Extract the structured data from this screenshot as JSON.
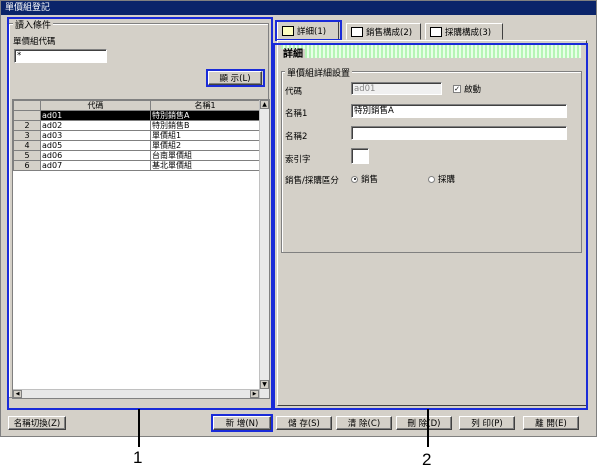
{
  "window": {
    "title": "單價組登記"
  },
  "left_panel": {
    "group_label": "讀入條件",
    "code_label": "單價組代碼",
    "code_value": "*",
    "show_button": "顯 示(L)",
    "grid": {
      "columns": [
        "代碼",
        "名稱1"
      ],
      "rows": [
        {
          "num": "",
          "code": "ad01",
          "name": "特別銷售A"
        },
        {
          "num": "2",
          "code": "ad02",
          "name": "特別銷售B"
        },
        {
          "num": "3",
          "code": "ad03",
          "name": "單價組1"
        },
        {
          "num": "4",
          "code": "ad05",
          "name": "單價組2"
        },
        {
          "num": "5",
          "code": "ad06",
          "name": "台南單價組"
        },
        {
          "num": "6",
          "code": "ad07",
          "name": "基北單價組"
        }
      ]
    }
  },
  "tabs": [
    {
      "label": "詳細(1)"
    },
    {
      "label": "銷售構成(2)"
    },
    {
      "label": "採購構成(3)"
    }
  ],
  "detail": {
    "header": "詳細",
    "group_label": "單價組詳細設置",
    "code_label": "代碼",
    "code_value": "ad01",
    "active_label": "啟動",
    "active_mark": "✓",
    "name1_label": "名稱1",
    "name1_value": "特別銷售A",
    "name2_label": "名稱2",
    "name2_value": "",
    "index_label": "索引字",
    "index_value": "",
    "sales_purchase_label": "銷售/採購區分",
    "radio_sales": "銷售",
    "radio_purchase": "採購"
  },
  "bottom_buttons": {
    "switch": "名稱切換(Z)",
    "new": "新 增(N)",
    "save": "儲 存(S)",
    "clear": "清 除(C)",
    "delete": "刪 除(D)",
    "print": "列 印(P)",
    "close": "離 開(E)"
  },
  "callouts": {
    "one": "1",
    "two": "2"
  }
}
